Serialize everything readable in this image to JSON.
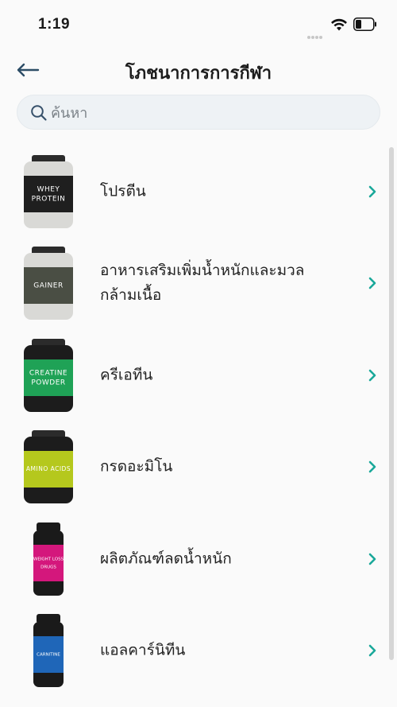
{
  "status_bar": {
    "time": "1:19"
  },
  "header": {
    "title": "โภชนาการการกีฬา"
  },
  "search": {
    "placeholder": "ค้นหา"
  },
  "accent_color": "#1aa89a",
  "items": [
    {
      "label": "โปรตีน",
      "thumb_text": "WHEY PROTEIN",
      "thumb_lines": [
        "WHEY",
        "PROTEIN"
      ],
      "label_color": "#1f1f1f",
      "label_bg": "#1f1f1f",
      "thumb_type": "tub-grey"
    },
    {
      "label": "อาหารเสริมเพิ่มน้ำหนักและมวลกล้ามเนื้อ",
      "thumb_lines": [
        "GAINER"
      ],
      "label_bg": "#4a4e44",
      "thumb_type": "tub-grey"
    },
    {
      "label": "ครีเอทีน",
      "thumb_lines": [
        "CREATINE",
        "POWDER"
      ],
      "label_bg": "#1fa256",
      "thumb_type": "tub-black"
    },
    {
      "label": "กรดอะมิโน",
      "thumb_lines": [
        "AMINO ACIDS"
      ],
      "label_bg": "#b5c81d",
      "thumb_type": "tub-black"
    },
    {
      "label": "ผลิตภัณฑ์ลดน้ำหนัก",
      "thumb_lines": [
        "WEIGHT LOSS",
        "DRUGS"
      ],
      "label_bg": "#d4177c",
      "thumb_type": "bottle"
    },
    {
      "label": "แอลคาร์นิทีน",
      "thumb_lines": [
        "CARNITINE"
      ],
      "label_bg": "#1f66b8",
      "thumb_type": "bottle"
    }
  ]
}
